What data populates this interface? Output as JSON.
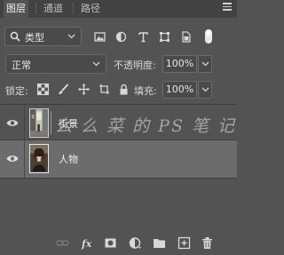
{
  "tabs": [
    {
      "label": "图层",
      "active": true
    },
    {
      "label": "通道",
      "active": false
    },
    {
      "label": "路径",
      "active": false
    }
  ],
  "filter": {
    "label": "类型"
  },
  "blend_mode": {
    "value": "正常"
  },
  "opacity": {
    "label": "不透明度:",
    "value": "100%"
  },
  "lock": {
    "label": "锁定:"
  },
  "fill": {
    "label": "填充:",
    "value": "100%"
  },
  "layers": [
    {
      "name": "街景",
      "visible": true,
      "selected": false
    },
    {
      "name": "人物",
      "visible": true,
      "selected": true
    }
  ],
  "watermark": "么 么 菜 的 PS 笔 记",
  "colors": {
    "panel": "#535353",
    "tabbar": "#424242",
    "selected_layer": "#6c6c6c"
  }
}
